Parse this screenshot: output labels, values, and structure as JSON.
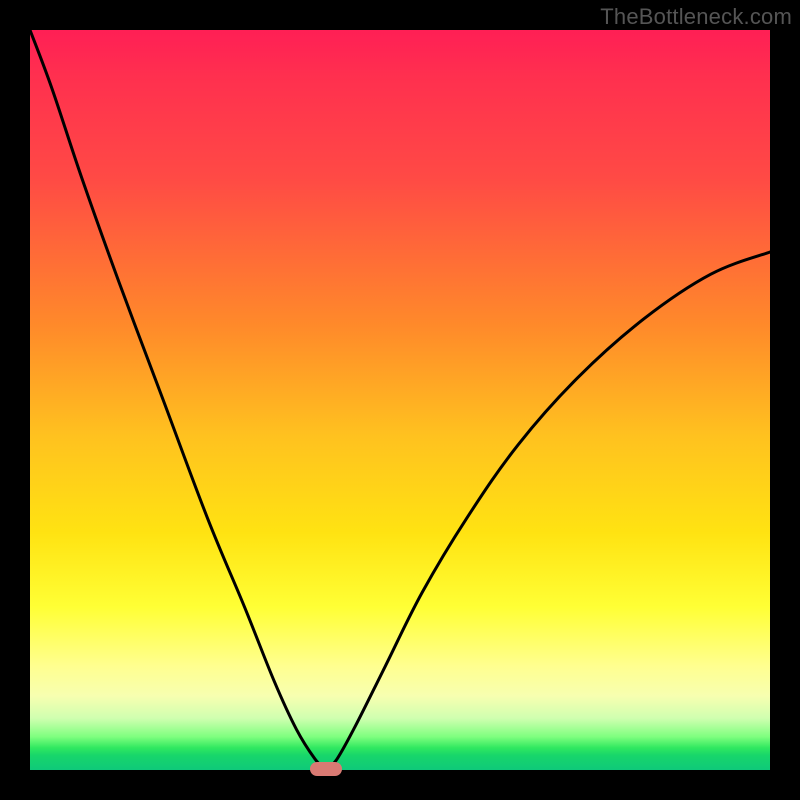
{
  "watermark": {
    "text": "TheBottleneck.com"
  },
  "colors": {
    "frame": "#000000",
    "curve": "#000000",
    "marker": "#d97a73",
    "gradient_stops": [
      "#ff1f55",
      "#ff2f4f",
      "#ff4a45",
      "#ff8a2a",
      "#ffc21f",
      "#ffe312",
      "#ffff35",
      "#ffff90",
      "#f7ffb0",
      "#d0ffb0",
      "#7fff7f",
      "#30e860",
      "#18d66a",
      "#0fc97a"
    ]
  },
  "chart_data": {
    "type": "line",
    "title": "",
    "xlabel": "",
    "ylabel": "",
    "xlim": [
      0,
      1
    ],
    "ylim": [
      0,
      1
    ],
    "description": "Bottleneck-style V-curve with sharp minimum reaching 0 at x≈0.40; left branch rises steeply to 1.0 at x=0, right branch rises to ≈0.70 at x=1.",
    "minimum_x": 0.4,
    "marker": {
      "x": 0.4,
      "y": 0.0
    },
    "series": [
      {
        "name": "left-branch",
        "x": [
          0.0,
          0.03,
          0.07,
          0.12,
          0.18,
          0.24,
          0.29,
          0.33,
          0.36,
          0.385,
          0.4
        ],
        "y": [
          1.0,
          0.92,
          0.8,
          0.66,
          0.5,
          0.34,
          0.22,
          0.12,
          0.055,
          0.015,
          0.0
        ]
      },
      {
        "name": "right-branch",
        "x": [
          0.4,
          0.415,
          0.44,
          0.48,
          0.53,
          0.59,
          0.66,
          0.74,
          0.83,
          0.92,
          1.0
        ],
        "y": [
          0.0,
          0.015,
          0.06,
          0.14,
          0.24,
          0.34,
          0.44,
          0.53,
          0.61,
          0.67,
          0.7
        ]
      }
    ]
  }
}
